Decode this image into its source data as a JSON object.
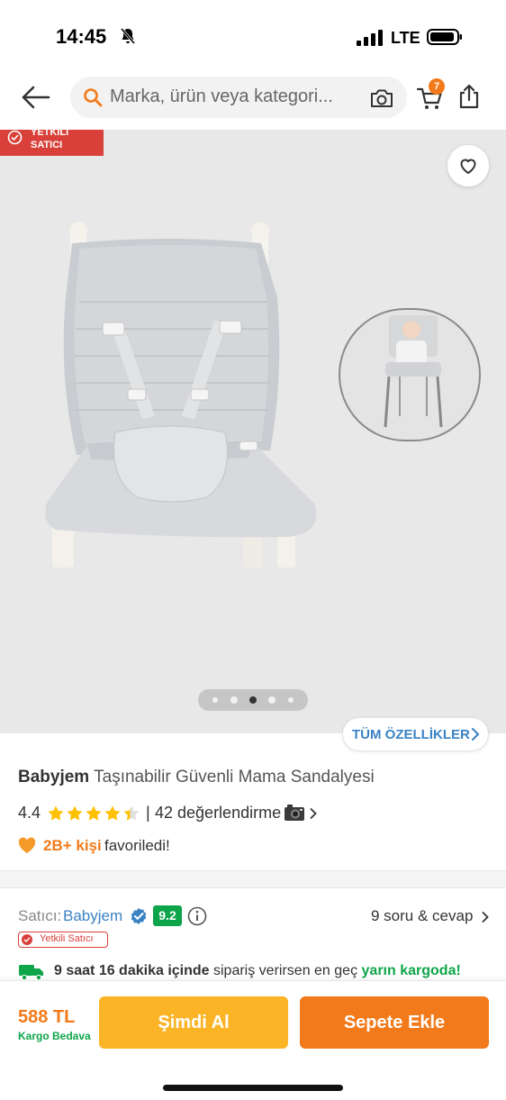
{
  "status_bar": {
    "time": "14:45",
    "network": "LTE",
    "icons": [
      "bell-off-icon",
      "signal-icon",
      "battery-icon"
    ]
  },
  "header": {
    "search_placeholder": "Marka, ürün veya kategori...",
    "cart_count": "7",
    "icons": [
      "back-arrow-icon",
      "search-icon",
      "camera-icon",
      "cart-icon",
      "share-icon"
    ]
  },
  "gallery": {
    "seller_flag_line1": "YETKİLİ",
    "seller_flag_line2": "SATICI",
    "dot_count": 5,
    "active_dot": 2,
    "features_label": "TÜM ÖZELLİKLER"
  },
  "product": {
    "brand": "Babyjem",
    "name": "Taşınabilir Güvenli Mama Sandalyesi",
    "rating": "4.4",
    "rating_value": 4.4,
    "reviews": "42 değerlendirme",
    "favorites_count": "2B+ kişi",
    "favorites_label": "favoriledi!"
  },
  "seller": {
    "label": "Satıcı:",
    "name": "Babyjem",
    "score": "9.2",
    "badge": "Yetkili Satıcı",
    "qa_link": "9 soru & cevap"
  },
  "shipping": {
    "time_bold": "9 saat 16 dakika içinde",
    "middle": "sipariş verirsen en geç",
    "highlight": "yarın kargoda!"
  },
  "bottom_bar": {
    "price": "588 TL",
    "cargo": "Kargo Bedava",
    "buy_now": "Şimdi Al",
    "add_to_cart": "Sepete Ekle"
  },
  "colors": {
    "accent_orange": "#f27a1a",
    "buy_now_yellow": "#fcb427",
    "link_blue": "#3b82c4",
    "success_green": "#0ea54a",
    "seller_red": "#d9403a"
  }
}
